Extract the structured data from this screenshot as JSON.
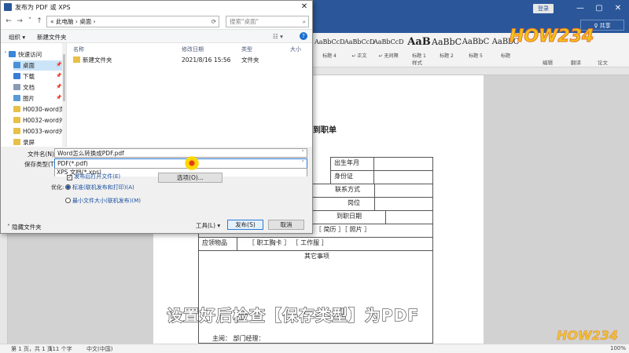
{
  "word": {
    "signin": "登录",
    "window_controls": [
      "—",
      "▢",
      "✕"
    ],
    "share": "♀ 共享",
    "styles": [
      {
        "sample": "AaBbCcD",
        "name": "标题 4"
      },
      {
        "sample": "AaBbCcD",
        "name": "↵ 正文"
      },
      {
        "sample": "AaBbCcD",
        "name": "↵ 无间隔"
      },
      {
        "sample": "AaB",
        "name": "标题 1"
      },
      {
        "sample": "AaBbC",
        "name": "标题 2"
      },
      {
        "sample": "AaBbC",
        "name": "标题 5"
      },
      {
        "sample": "AaBbC",
        "name": "标题"
      }
    ],
    "ribbon_groups": [
      "样式",
      "编辑",
      "翻译",
      "论文"
    ],
    "doc_title": "到职单",
    "table": {
      "birth": "出生年月",
      "id": "身份证",
      "contact": "联系方式",
      "post": "岗位",
      "join_date": "到职日期",
      "resume": "［ 简历 ］［ 照片 ］",
      "items_label": "应领物品",
      "items": "［ 职工胸卡 ］ ［ 工作服 ］",
      "other": "其它事项",
      "sign": "主阅：     部门经理："
    },
    "status": {
      "page": "第 1 页，共 1 页",
      "words": "111 个字",
      "lang": "中文(中国)",
      "zoom": "100%"
    },
    "subtitle": "设置好后检查【保存类型】为PDF",
    "watermark": "HOW234"
  },
  "dialog": {
    "title": "发布为 PDF 或 XPS",
    "close": "✕",
    "path": [
      "此电脑",
      "桌面"
    ],
    "path_text": "« 此电脑 › 桌面 ›",
    "search_placeholder": "搜索\"桌面\"",
    "toolbar": {
      "organize": "组织 ▾",
      "new_folder": "新建文件夹",
      "help": "?"
    },
    "nav": [
      {
        "label": "快速访问",
        "icon": "star-icon",
        "color": "#3a86d9"
      },
      {
        "label": "桌面",
        "icon": "desktop-icon",
        "color": "#4a90d9"
      },
      {
        "label": "下载",
        "icon": "download-icon",
        "color": "#3a7bd5"
      },
      {
        "label": "文档",
        "icon": "document-icon",
        "color": "#8a9bb3"
      },
      {
        "label": "图片",
        "icon": "picture-icon",
        "color": "#5a9ad5"
      },
      {
        "label": "H0030-word页...",
        "icon": "folder-icon",
        "color": "#e8c048"
      },
      {
        "label": "H0032-word外...",
        "icon": "folder-icon",
        "color": "#e8c048"
      },
      {
        "label": "H0033-word外...",
        "icon": "folder-icon",
        "color": "#e8c048"
      },
      {
        "label": "录屏",
        "icon": "folder-icon",
        "color": "#e8c048"
      }
    ],
    "columns": [
      "名称",
      "修改日期",
      "类型",
      "大小"
    ],
    "files": [
      {
        "name": "新建文件夹",
        "date": "2021/8/16 15:56",
        "type": "文件夹",
        "size": ""
      }
    ],
    "filename_label": "文件名(N):",
    "filename_value": "Word怎么转换成PDF.pdf",
    "type_label": "保存类型(T):",
    "type_options": [
      "PDF(*.pdf)",
      "XPS 文档(*.xps)"
    ],
    "open_after": "发布后打开文件(E)",
    "options_button": "选项(O)...",
    "optimize_label": "优化:",
    "opt_standard": "标准(联机发布和打印)(A)",
    "opt_min": "最小文件大小(联机发布)(M)",
    "hide_folders": "隐藏文件夹",
    "tools_button": "工具(L)",
    "publish_button": "发布(S)",
    "cancel_button": "取消"
  }
}
